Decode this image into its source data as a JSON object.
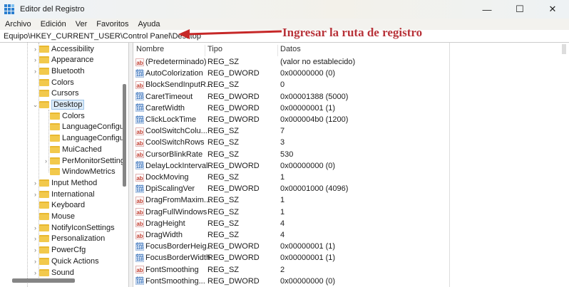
{
  "window": {
    "title": "Editor del Registro",
    "minimize": "—",
    "maximize": "☐",
    "close": "✕"
  },
  "menu": [
    "Archivo",
    "Edición",
    "Ver",
    "Favoritos",
    "Ayuda"
  ],
  "address": "Equipo\\HKEY_CURRENT_USER\\Control Panel\\Desktop",
  "annotation": "Ingresar la ruta de registro",
  "annotation_color": "#b8333a",
  "tree": [
    {
      "label": "Accessibility",
      "level": 1,
      "chev": "›"
    },
    {
      "label": "Appearance",
      "level": 1,
      "chev": "›"
    },
    {
      "label": "Bluetooth",
      "level": 1,
      "chev": "›"
    },
    {
      "label": "Colors",
      "level": 1,
      "chev": ""
    },
    {
      "label": "Cursors",
      "level": 1,
      "chev": ""
    },
    {
      "label": "Desktop",
      "level": 1,
      "chev": "⌄",
      "selected": true
    },
    {
      "label": "Colors",
      "level": 2,
      "chev": ""
    },
    {
      "label": "LanguageConfigu",
      "level": 2,
      "chev": ""
    },
    {
      "label": "LanguageConfigu",
      "level": 2,
      "chev": ""
    },
    {
      "label": "MuiCached",
      "level": 2,
      "chev": ""
    },
    {
      "label": "PerMonitorSetting",
      "level": 2,
      "chev": "›"
    },
    {
      "label": "WindowMetrics",
      "level": 2,
      "chev": ""
    },
    {
      "label": "Input Method",
      "level": 1,
      "chev": "›"
    },
    {
      "label": "International",
      "level": 1,
      "chev": "›"
    },
    {
      "label": "Keyboard",
      "level": 1,
      "chev": ""
    },
    {
      "label": "Mouse",
      "level": 1,
      "chev": ""
    },
    {
      "label": "NotifyIconSettings",
      "level": 1,
      "chev": "›"
    },
    {
      "label": "Personalization",
      "level": 1,
      "chev": "›"
    },
    {
      "label": "PowerCfg",
      "level": 1,
      "chev": "›"
    },
    {
      "label": "Quick Actions",
      "level": 1,
      "chev": "›"
    },
    {
      "label": "Sound",
      "level": 1,
      "chev": "›"
    }
  ],
  "columns": {
    "name": "Nombre",
    "type": "Tipo",
    "data": "Datos"
  },
  "rows": [
    {
      "name": "(Predeterminado)",
      "type": "REG_SZ",
      "data": "(valor no establecido)"
    },
    {
      "name": "AutoColorization",
      "type": "REG_DWORD",
      "data": "0x00000000 (0)"
    },
    {
      "name": "BlockSendInputR...",
      "type": "REG_SZ",
      "data": "0"
    },
    {
      "name": "CaretTimeout",
      "type": "REG_DWORD",
      "data": "0x00001388 (5000)"
    },
    {
      "name": "CaretWidth",
      "type": "REG_DWORD",
      "data": "0x00000001 (1)"
    },
    {
      "name": "ClickLockTime",
      "type": "REG_DWORD",
      "data": "0x000004b0 (1200)"
    },
    {
      "name": "CoolSwitchColu...",
      "type": "REG_SZ",
      "data": "7"
    },
    {
      "name": "CoolSwitchRows",
      "type": "REG_SZ",
      "data": "3"
    },
    {
      "name": "CursorBlinkRate",
      "type": "REG_SZ",
      "data": "530"
    },
    {
      "name": "DelayLockInterval",
      "type": "REG_DWORD",
      "data": "0x00000000 (0)"
    },
    {
      "name": "DockMoving",
      "type": "REG_SZ",
      "data": "1"
    },
    {
      "name": "DpiScalingVer",
      "type": "REG_DWORD",
      "data": "0x00001000 (4096)"
    },
    {
      "name": "DragFromMaxim...",
      "type": "REG_SZ",
      "data": "1"
    },
    {
      "name": "DragFullWindows",
      "type": "REG_SZ",
      "data": "1"
    },
    {
      "name": "DragHeight",
      "type": "REG_SZ",
      "data": "4"
    },
    {
      "name": "DragWidth",
      "type": "REG_SZ",
      "data": "4"
    },
    {
      "name": "FocusBorderHeig...",
      "type": "REG_DWORD",
      "data": "0x00000001 (1)"
    },
    {
      "name": "FocusBorderWidth",
      "type": "REG_DWORD",
      "data": "0x00000001 (1)"
    },
    {
      "name": "FontSmoothing",
      "type": "REG_SZ",
      "data": "2"
    },
    {
      "name": "FontSmoothing...",
      "type": "REG_DWORD",
      "data": "0x00000000 (0)"
    }
  ]
}
